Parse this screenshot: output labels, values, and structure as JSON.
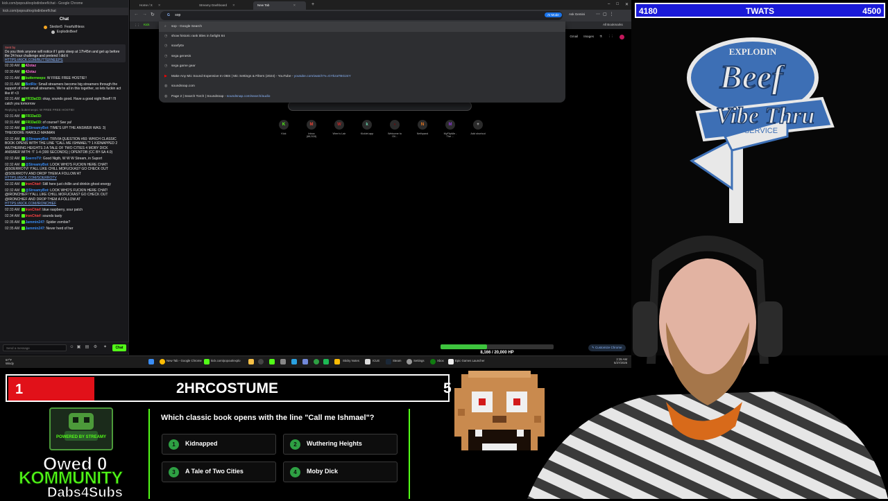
{
  "chat_window": {
    "title": "kick.com/popout/explodinbeef/chat - Google Chrome",
    "url": "kick.com/popout/explodinbeef/chat",
    "header": "Chat",
    "leaders": [
      "Stedon5",
      "Fearfulthless",
      "ExplodinBeef"
    ],
    "pinned": {
      "by": "Sent by",
      "text": "Do you think anyone will notice if I goto sleep at 17h45m and get up before the 24 hour challenge and pretend I did it",
      "link": "HTTPS://KICK.COM/BUTTERNEEPS"
    },
    "messages": [
      {
        "time": "02:30 AM",
        "user": "42otaz",
        "text": "",
        "color": "#ff6fd5"
      },
      {
        "time": "02:30 AM",
        "user": "42otaz",
        "text": "",
        "color": "#ff6fd5"
      },
      {
        "time": "02:31 AM",
        "user": "butterneeps",
        "text": ": W FREE FREE HOSTIE!!",
        "color": "#53fc18"
      },
      {
        "time": "02:31 AM",
        "user": "BotRix",
        "text": ": Small streamers become big streamers through the support of other small streamers. We're all in this together, so lets fuckin act like it! <3",
        "color": "#3a8df5"
      },
      {
        "time": "02:31 AM",
        "user": "FR33at33",
        "text": ": okay, sounds good. Have a good night Beef!! I'll catch you tomorrow",
        "color": "#53fc18"
      },
      {
        "time": "",
        "user": "",
        "text": "Replying to butterneeps: W FREE FREE HOSTIE!",
        "reply": true,
        "color": "#888"
      },
      {
        "time": "02:31 AM",
        "user": "FR33at33",
        "text": ":",
        "color": "#53fc18"
      },
      {
        "time": "02:31 AM",
        "user": "FR33at33",
        "text": ": of course!! See ya!",
        "color": "#53fc18"
      },
      {
        "time": "02:32 AM",
        "user": "@StreamyBot",
        "text": ": TIME'S UP! THE ANSWER WAS: 3) THEODORE HAROLD MAIMAN",
        "color": "#3a8df5"
      },
      {
        "time": "02:32 AM",
        "user": "@StreamyBot",
        "text": ": TRIVIA QUESTION #60: WHICH CLASSIC BOOK OPENS WITH THE LINE \"CALL ME ISHMAEL\"? 1 KIDNAPPED 2 WUTHERING HEIGHTS 3 A TALE OF TWO CITIES 4 MOBY DICK ANSWER WITH: !T 1-4 (300 SECONDS) | OPENTDB (CC BY-SA 4.0)",
        "color": "#3a8df5"
      },
      {
        "time": "02:32 AM",
        "user": "SoerroTV",
        "text": ": Good Nigth, W W W Stream, in Suport",
        "color": "#3a8df5"
      },
      {
        "time": "02:32 AM",
        "user": "@StreamyBot",
        "text": ": LOOK WHO'S FUCKIN HERE CHAT! @SOERROTV! Y'ALL LIKE CHILL MOFUCKAS? GO CHECK OUT @SOERROTV AND DROP THEM A FOLLOW AT",
        "link": "HTTPS://KICK.COM/SOERROTV",
        "color": "#3a8df5"
      },
      {
        "time": "02:32 AM",
        "user": "IronChief",
        "text": ": Still here just chillin and drinkin ghost energy",
        "color": "#ff4444"
      },
      {
        "time": "02:32 AM",
        "user": "@StreamyBot",
        "text": ": LOOK WHO'S FUCKIN HERE CHAT! @IRONCHIEF! Y'ALL LIKE CHILL MOFUCKAS? GO CHECK OUT @IRONCHIEF AND DROP THEM A FOLLOW AT",
        "link": "HTTPS://KICK.COM/IRONCHIEF",
        "color": "#3a8df5"
      },
      {
        "time": "02:33 AM",
        "user": "IronChief",
        "text": ": blue raspberry, sour patch",
        "color": "#ff4444"
      },
      {
        "time": "02:34 AM",
        "user": "IronChief",
        "text": ": sounds tasty",
        "color": "#ff4444"
      },
      {
        "time": "02:35 AM",
        "user": "Jammin247",
        "text": ": Spider zombie?",
        "color": "#3a8df5"
      },
      {
        "time": "02:35 AM",
        "user": "Jammin247",
        "text": ": Never herd of her",
        "color": "#3a8df5"
      }
    ],
    "input_placeholder": "Send a message",
    "send_label": "Chat"
  },
  "browser": {
    "tabs": [
      {
        "label": "Home / X"
      },
      {
        "label": "Streamy Dashboard"
      },
      {
        "label": "New Tab"
      }
    ],
    "omnibox_text": "sop",
    "ai_mode": "AI Mode",
    "ask_gemini": "Ask Gemini",
    "bookmark_kick": "Kick",
    "all_bookmarks": "All Bookmarks",
    "suggestions": [
      {
        "text": "sop - Google Search",
        "icon": "search-icon"
      },
      {
        "text": "show historic rank titles in farlight 84",
        "icon": "clock-icon"
      },
      {
        "text": "soarfyttv",
        "icon": "clock-icon"
      },
      {
        "text": "sega genesis",
        "icon": "clock-icon"
      },
      {
        "text": "sega game gear",
        "icon": "clock-icon"
      },
      {
        "text": "Make Any Mic Sound Expensive In OBS | Mic Settings & Filters (2024) - YouTube",
        "url": "youtube.com/watch?v=GYkzaTBG24Y",
        "icon": "youtube-icon"
      },
      {
        "text": "soundsnap.com",
        "icon": "globe-icon"
      },
      {
        "text": "Page 2 | Search Torch | Soundsnap",
        "url": "soundsnap.com/search/audio",
        "icon": "globe-icon"
      }
    ],
    "google_links": [
      "Gmail",
      "Images"
    ],
    "shortcuts": [
      {
        "label": "Kick",
        "glyph": "K",
        "color": "#53fc18"
      },
      {
        "label": "Inbox (88,518)",
        "glyph": "M",
        "color": "#ea4335"
      },
      {
        "label": "Wren's Lair",
        "glyph": "W",
        "color": "#c62828"
      },
      {
        "label": "Kicklet.app",
        "glyph": "k",
        "color": "#6bd6b0"
      },
      {
        "label": "Welcome to Oil...",
        "glyph": "●",
        "color": "#5a1414"
      },
      {
        "label": "Nethpand",
        "glyph": "N",
        "color": "#f57c20"
      },
      {
        "label": "MyFlipMe - The ...",
        "glyph": "M",
        "color": "#8a3ad8"
      },
      {
        "label": "Add shortcut",
        "glyph": "+",
        "color": "#cccccc"
      }
    ],
    "customize": "Customize Chrome"
  },
  "hp_bar": {
    "text": "8,166 / 20,000 HP",
    "fraction": 0.408
  },
  "taskbar": {
    "weather": "67°F",
    "weather_sub": "Windy",
    "items": [
      "New Tab - Google Chrome",
      "kick.com/popout/explo",
      "Sticky Notes",
      "ICUE",
      "Steam",
      "Settings",
      "Xbox",
      "Epic Games Launcher"
    ],
    "time": "2:35 AM",
    "date": "5/27/2026"
  },
  "score_bar": {
    "left": "4180",
    "title": "TWATS",
    "right": "4500"
  },
  "counter": {
    "number": "1",
    "title": "2HRCOSTUME",
    "edge": "5"
  },
  "overlay": {
    "owed": "Owed 0",
    "kommunity": "KOMMUNITY",
    "dabs": "Dabs4Subs",
    "streamy_text": "POWERED BY STREAMY",
    "beef_logo_line1": "EXPLODIN",
    "beef_logo_line2": "Beef",
    "beef_logo_line3": "Vibe Thru",
    "beef_logo_line4": "SERVICE"
  },
  "trivia": {
    "question": "Which classic book opens with the line \"Call me Ishmael\"?",
    "answers": [
      {
        "num": "1",
        "label": "Kidnapped"
      },
      {
        "num": "2",
        "label": "Wuthering Heights"
      },
      {
        "num": "3",
        "label": "A Tale of Two Cities"
      },
      {
        "num": "4",
        "label": "Moby Dick"
      }
    ]
  }
}
